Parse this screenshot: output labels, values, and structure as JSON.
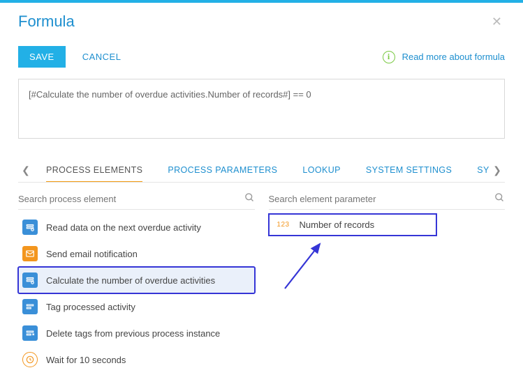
{
  "header": {
    "title": "Formula"
  },
  "actions": {
    "save": "SAVE",
    "cancel": "CANCEL",
    "readMore": "Read more about formula"
  },
  "formula": {
    "text": "[#Calculate the number of overdue activities.Number of records#] == 0"
  },
  "tabs": {
    "items": [
      "PROCESS ELEMENTS",
      "PROCESS PARAMETERS",
      "LOOKUP",
      "SYSTEM SETTINGS",
      "SYSTEM"
    ],
    "activeIndex": 0
  },
  "leftCol": {
    "searchPlaceholder": "Search process element",
    "items": [
      {
        "label": "Read data on the next overdue activity",
        "iconClass": "ic-read"
      },
      {
        "label": "Send email notification",
        "iconClass": "ic-email"
      },
      {
        "label": "Calculate the number of overdue activities",
        "iconClass": "ic-read"
      },
      {
        "label": "Tag processed activity",
        "iconClass": "ic-tag"
      },
      {
        "label": "Delete tags from previous process instance",
        "iconClass": "ic-delete"
      },
      {
        "label": "Wait for 10 seconds",
        "iconClass": "ic-timer"
      }
    ],
    "selectedIndex": 2
  },
  "rightCol": {
    "searchPlaceholder": "Search element parameter",
    "paramType": "123",
    "paramLabel": "Number of records"
  }
}
